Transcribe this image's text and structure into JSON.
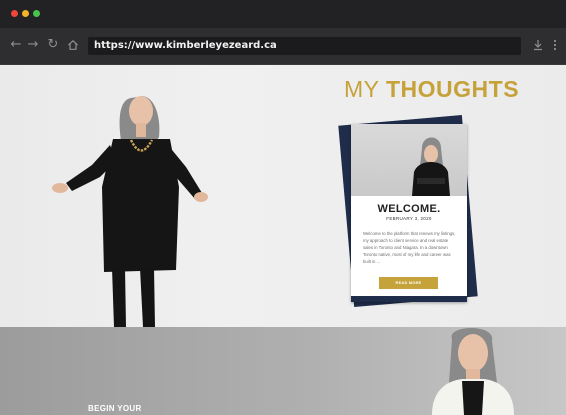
{
  "browser": {
    "url": "https://www.kimberleyezeard.ca",
    "traffic_lights": [
      "#f0453a",
      "#f5b32a",
      "#47c44e"
    ]
  },
  "hero": {
    "heading_word1": "MY",
    "heading_word2": "THOUGHTS",
    "accent_color": "#c5a23a",
    "navy_color": "#1f2d4a"
  },
  "blog_card": {
    "title": "WELCOME.",
    "date": "FEBRUARY 3, 2020",
    "excerpt": "Welcome to the platform that renews my listings, my approach to client service and real estate sales in Toronto and Niagara. In a downtown Toronto native, most of my life and career was built in ...",
    "button_label": "READ MORE"
  },
  "section2": {
    "heading": "BEGIN YOUR"
  }
}
